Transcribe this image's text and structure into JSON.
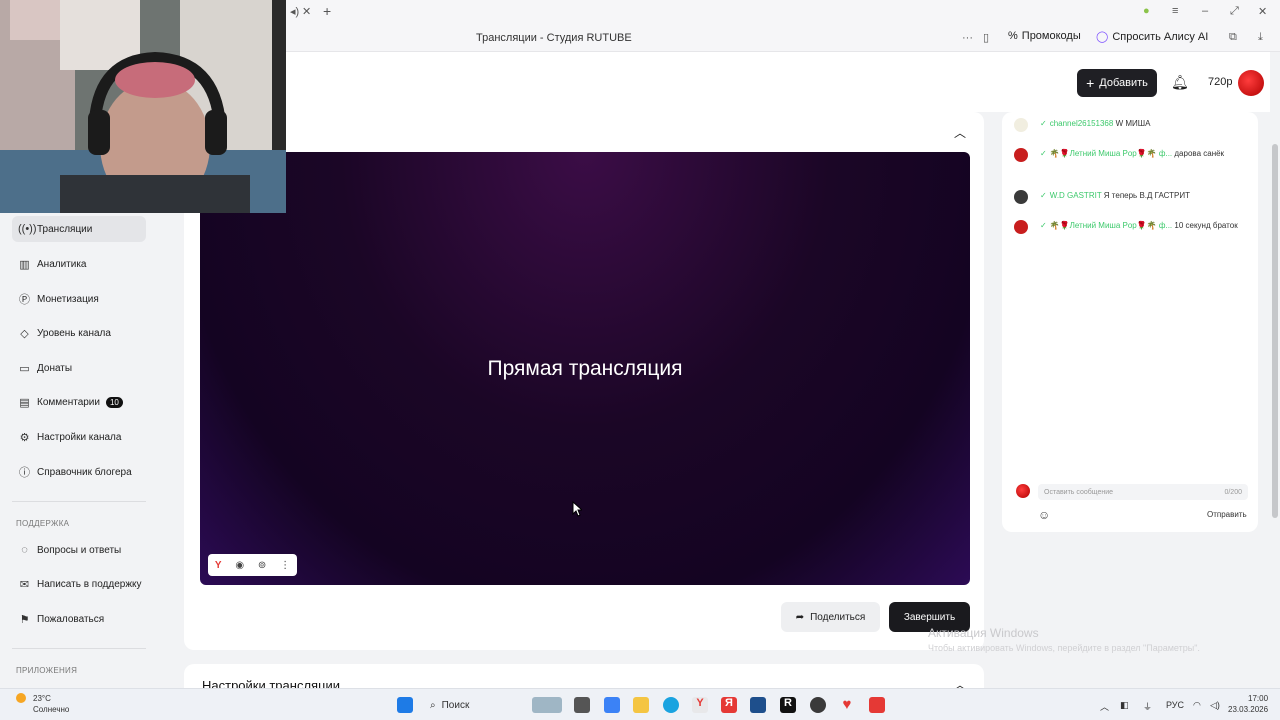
{
  "browser": {
    "page_title": "Трансляции - Студия RUTUBE",
    "promo_label": "Промокоды",
    "alice_label": "Спросить Алису AI"
  },
  "header": {
    "add_label": "Добавить",
    "quality": "720p"
  },
  "sidebar": {
    "items": [
      {
        "label": "Трансляции",
        "icon": "broadcast-icon"
      },
      {
        "label": "Аналитика",
        "icon": "analytics-icon"
      },
      {
        "label": "Монетизация",
        "icon": "money-icon"
      },
      {
        "label": "Уровень канала",
        "icon": "level-icon"
      },
      {
        "label": "Донаты",
        "icon": "donate-icon"
      },
      {
        "label": "Комментарии",
        "icon": "comments-icon",
        "badge": "10"
      },
      {
        "label": "Настройки канала",
        "icon": "gear-icon"
      },
      {
        "label": "Справочник блогера",
        "icon": "book-icon"
      }
    ],
    "support_title": "ПОДДЕРЖКА",
    "support_items": [
      {
        "label": "Вопросы и ответы",
        "icon": "question-icon"
      },
      {
        "label": "Написать в поддержку",
        "icon": "mail-icon"
      },
      {
        "label": "Пожаловаться",
        "icon": "flag-icon"
      }
    ],
    "apps_title": "ПРИЛОЖЕНИЯ"
  },
  "player": {
    "title": "Прямая трансляция"
  },
  "actions": {
    "share_label": "Поделиться",
    "finish_label": "Завершить"
  },
  "settings": {
    "title": "Настройки трансляции"
  },
  "chat": {
    "messages": [
      {
        "name": "channel26151368",
        "text": "W МИША",
        "avatar_color": "#f1eee0"
      },
      {
        "name": "🌴🌹Летний Миша Pop🌹🌴 ф...",
        "text": "дарова санёк",
        "avatar_color": "#c81e1e"
      },
      {
        "name": "W.D GASTRIT",
        "text": "Я теперь В.Д ГАСТРИТ",
        "avatar_color": "#3a3a3a"
      },
      {
        "name": "🌴🌹Летний Миша Pop🌹🌴 ф...",
        "text": "10 секунд браток",
        "avatar_color": "#c81e1e"
      }
    ],
    "input_placeholder": "Оставить сообщение",
    "counter": "0/200",
    "send_label": "Отправить"
  },
  "watermark": {
    "line1": "Активация Windows",
    "line2": "Чтобы активировать Windows, перейдите в раздел \"Параметры\"."
  },
  "taskbar": {
    "temperature": "23°C",
    "weather": "Солнечно",
    "search_label": "Поиск",
    "language": "РУС",
    "time": "17:00",
    "date": "23.03.2026"
  }
}
